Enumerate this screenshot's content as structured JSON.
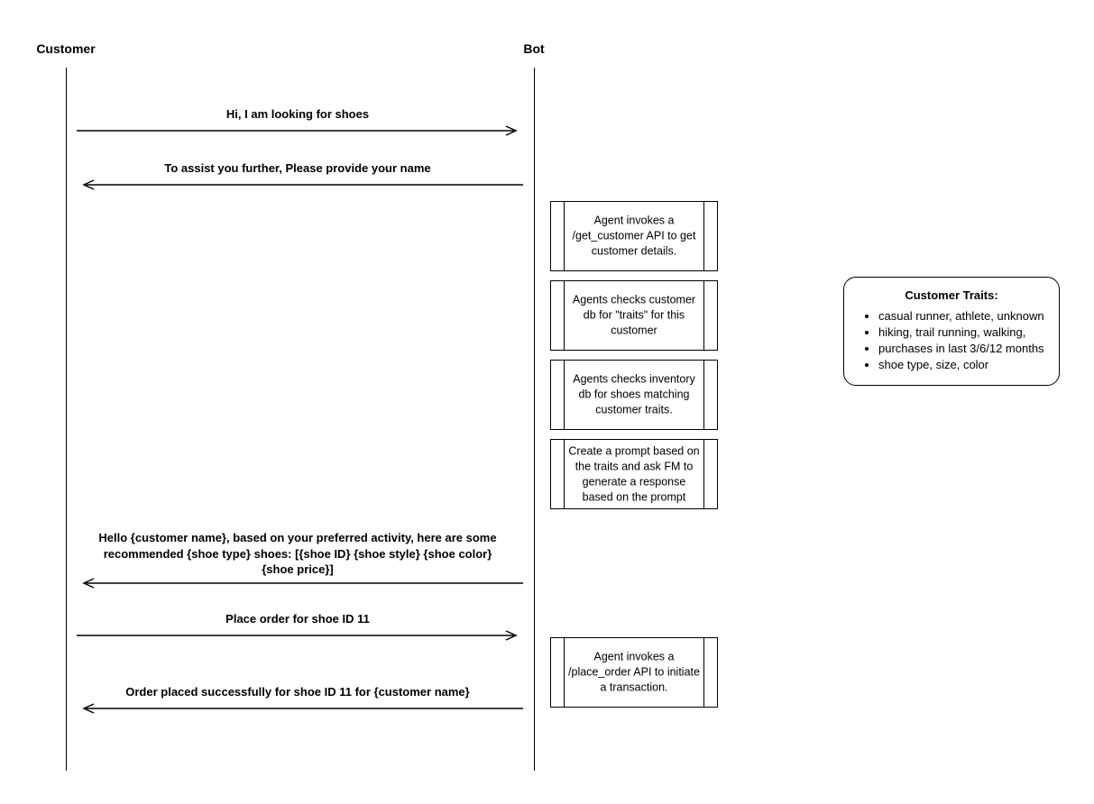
{
  "actors": {
    "customer": "Customer",
    "bot": "Bot"
  },
  "messages": {
    "m1": "Hi, I am looking for shoes",
    "m2": "To assist you further, Please provide your name",
    "m3": "Hello {customer name}, based on your preferred activity, here are some recommended {shoe type} shoes: [{shoe ID} {shoe style} {shoe color} {shoe price}]",
    "m4": "Place order for shoe ID 11",
    "m5": "Order placed successfully for shoe ID 11 for {customer name}"
  },
  "selfcalls": {
    "s1": "Agent invokes a /get_customer API to get customer details.",
    "s2": "Agents checks customer db for \"traits\" for this customer",
    "s3": "Agents checks inventory db for shoes matching customer traits.",
    "s4": "Create a prompt based on the traits and ask FM to generate a response based on the prompt",
    "s5": "Agent invokes a /place_order API to initiate a transaction."
  },
  "note": {
    "title": "Customer Traits:",
    "items": [
      "casual runner, athlete, unknown",
      "hiking, trail running, walking,",
      "purchases in last 3/6/12 months",
      "shoe type, size, color"
    ]
  }
}
